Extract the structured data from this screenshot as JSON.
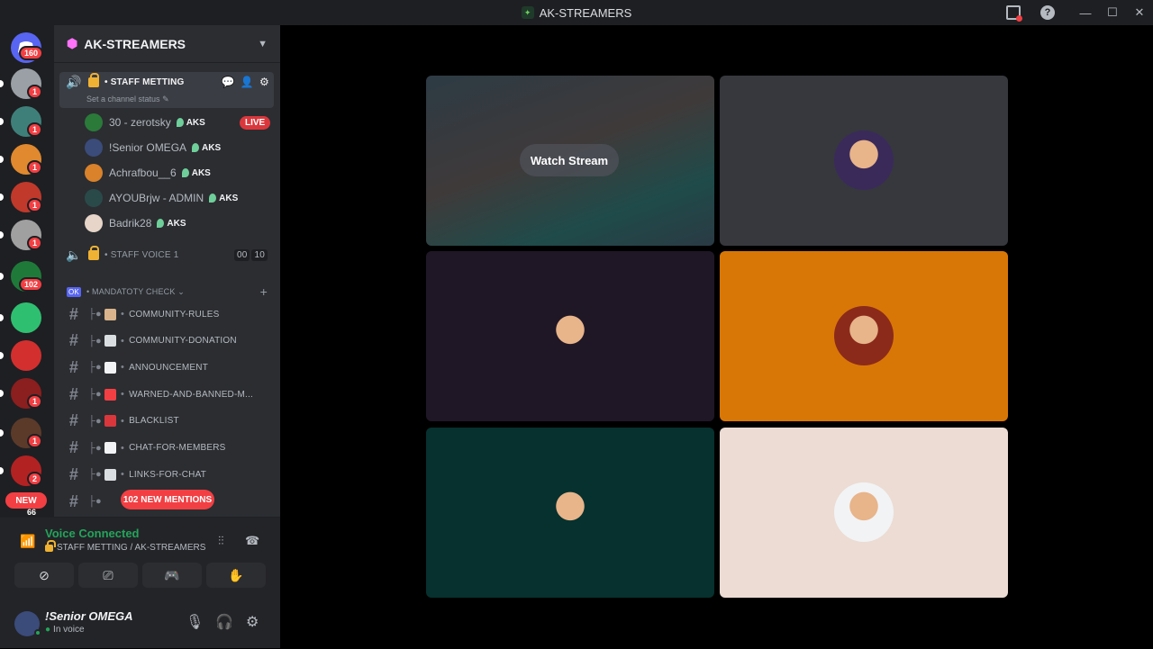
{
  "window": {
    "title": "AK-STREAMERS",
    "controls": [
      "inbox-icon",
      "help-icon",
      "minimize-icon",
      "maximize-icon",
      "close-icon"
    ]
  },
  "rail": {
    "home_badge": "160",
    "servers": [
      {
        "badge": "1",
        "color": "#9aa0a6"
      },
      {
        "badge": "1",
        "color": "#3f7f7a"
      },
      {
        "badge": "1",
        "color": "#e0892f"
      },
      {
        "badge": "1",
        "color": "#c0392b"
      },
      {
        "badge": "1",
        "color": "#a0a0a0"
      },
      {
        "badge": "102",
        "color": "#1f7a3a"
      },
      {
        "badge": "",
        "color": "#2fbf71"
      },
      {
        "badge": "",
        "color": "#d32f2f"
      },
      {
        "badge": "1",
        "color": "#8b1e1e"
      },
      {
        "badge": "1",
        "color": "#5b3a2a"
      },
      {
        "badge": "2",
        "color": "#b22222"
      }
    ],
    "new_label": "NEW",
    "new_count": "66"
  },
  "sidebar": {
    "guild_name": "AK-STREAMERS",
    "active_channel": "STAFF METTING",
    "channel_status_hint": "Set a channel status",
    "members": [
      {
        "name": "30 - zerotsky",
        "tag": "AKS",
        "live": "LIVE",
        "color": "#2b7a3a"
      },
      {
        "name": "!Senior OMEGA",
        "tag": "AKS",
        "live": "",
        "color": "#3b4b7a"
      },
      {
        "name": "Achrafbou__6",
        "tag": "AKS",
        "live": "",
        "color": "#d9822b"
      },
      {
        "name": "AYOUBrjw - ADMIN",
        "tag": "AKS",
        "live": "",
        "color": "#2a4a4a"
      },
      {
        "name": "Badrik28",
        "tag": "AKS",
        "live": "",
        "color": "#e6d5c8"
      }
    ],
    "staff_voice": {
      "name": "STAFF VOICE",
      "count": "1",
      "c1": "00",
      "c2": "10"
    },
    "category": {
      "badge": "OK",
      "name": "MANDATOTY CHECK"
    },
    "text_channels": [
      {
        "name": "COMMUNITY-RULES",
        "color": "#d9b38c"
      },
      {
        "name": "COMMUNITY-DONATION",
        "color": "#dbdee1"
      },
      {
        "name": "ANNOUNCEMENT",
        "color": "#f2f3f5"
      },
      {
        "name": "WARNED-AND-BANNED-M...",
        "color": "#f23f43"
      },
      {
        "name": "BLACKLIST",
        "color": "#da373c"
      },
      {
        "name": "CHAT-FOR-MEMBERS",
        "color": "#f2f3f5"
      },
      {
        "name": "LINKS-FOR-CHAT",
        "color": "#dbdee1"
      }
    ],
    "mentions_label": "102 NEW MENTIONS"
  },
  "voice_panel": {
    "status": "Voice Connected",
    "location": "STAFF METTING / AK-STREAMERS",
    "buttons": [
      "camera-off-icon",
      "screen-share-icon",
      "activity-icon",
      "soundboard-icon"
    ]
  },
  "user": {
    "name": "!Senior OMEGA",
    "status": "In voice"
  },
  "stage": {
    "watch_label": "Watch Stream",
    "tiles": [
      {
        "bg": "#2a3a44",
        "avatar": "",
        "stream": true
      },
      {
        "bg": "#36383d",
        "avatar": "#3a2a5a",
        "stream": false
      },
      {
        "bg": "#1f1726",
        "avatar": "#1f1726",
        "stream": false
      },
      {
        "bg": "#d97706",
        "avatar": "#8b2a1a",
        "stream": false
      },
      {
        "bg": "#06312e",
        "avatar": "#06312e",
        "stream": false
      },
      {
        "bg": "#ecdcd3",
        "avatar": "#f2f3f5",
        "stream": false
      }
    ]
  }
}
